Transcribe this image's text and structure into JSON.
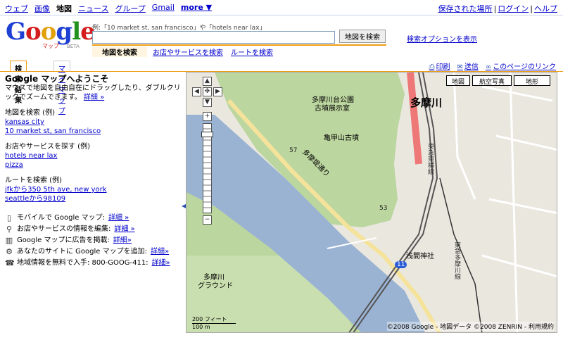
{
  "topnav": {
    "items": [
      "ウェブ",
      "画像",
      "地図",
      "ニュース",
      "グループ",
      "Gmail",
      "more ▼"
    ],
    "right_saved": "保存された場所",
    "right_login": "ログイン",
    "right_help": "ヘルプ",
    "sep": "|"
  },
  "logo": {
    "text": "Google",
    "sub": "マップ",
    "beta": "BETA"
  },
  "search": {
    "hint": "例:「10 market st, san francisco」や「hotels near lax」",
    "value": "",
    "button": "地図を検索",
    "options": "検索オプションを表示",
    "subtabs": [
      "地図を検索",
      "お店やサービスを検索",
      "ルートを検索"
    ]
  },
  "lefttabs": [
    "検索結果",
    "マイマップ"
  ],
  "toolbar": {
    "print": "印刷",
    "send": "送信",
    "link": "このページのリンク"
  },
  "panel": {
    "title": "Google マップへようこそ",
    "intro": "マウスで地図を自由自在にドラッグしたり、ダブルクリックでズームできます。",
    "details": "詳細 »",
    "map_search_label": "地図を検索 (例)",
    "map_search_examples": [
      "kansas city",
      "10 market st, san francisco"
    ],
    "business_label": "お店やサービスを探す (例)",
    "business_examples": [
      "hotels near lax",
      "pizza"
    ],
    "route_label": "ルートを検索 (例)",
    "route_examples": [
      "jfkから350 5th ave, new york",
      "seattleから98109"
    ],
    "promos": [
      {
        "icon": "mobile-icon",
        "text": "モバイルで Google マップ:",
        "link": "詳細 »"
      },
      {
        "icon": "pin-icon",
        "text": "お店やサービスの情報を編集:",
        "link": "詳細 »"
      },
      {
        "icon": "ad-icon",
        "text": "Google マップに広告を掲載:",
        "link": "詳細»"
      },
      {
        "icon": "gear-icon",
        "text": "あなたのサイトに Google マップを追加:",
        "link": "詳細»"
      },
      {
        "icon": "phone-icon",
        "text": "地域情報を無料で入手: 800-GOOG-411:",
        "link": "詳細»"
      }
    ]
  },
  "map": {
    "types": [
      "地図",
      "航空写真",
      "地形"
    ],
    "labels": {
      "river": "多摩川",
      "park": "多摩川台公園",
      "park2": "古墳展示室",
      "kofun": "亀甲山古墳",
      "road": "多摩堤通り",
      "line1": "東急東横線",
      "line2": "東急多摩川線",
      "shrine": "浅間神社",
      "ground1": "多摩川",
      "ground2": "グラウンド",
      "route_num": "11",
      "n57": "57",
      "n53": "53"
    },
    "scale_ft": "200 フィート",
    "scale_m": "100 m",
    "copyright": "©2008 Google - 地図データ ©2008 ZENRIN - 利用規約"
  }
}
